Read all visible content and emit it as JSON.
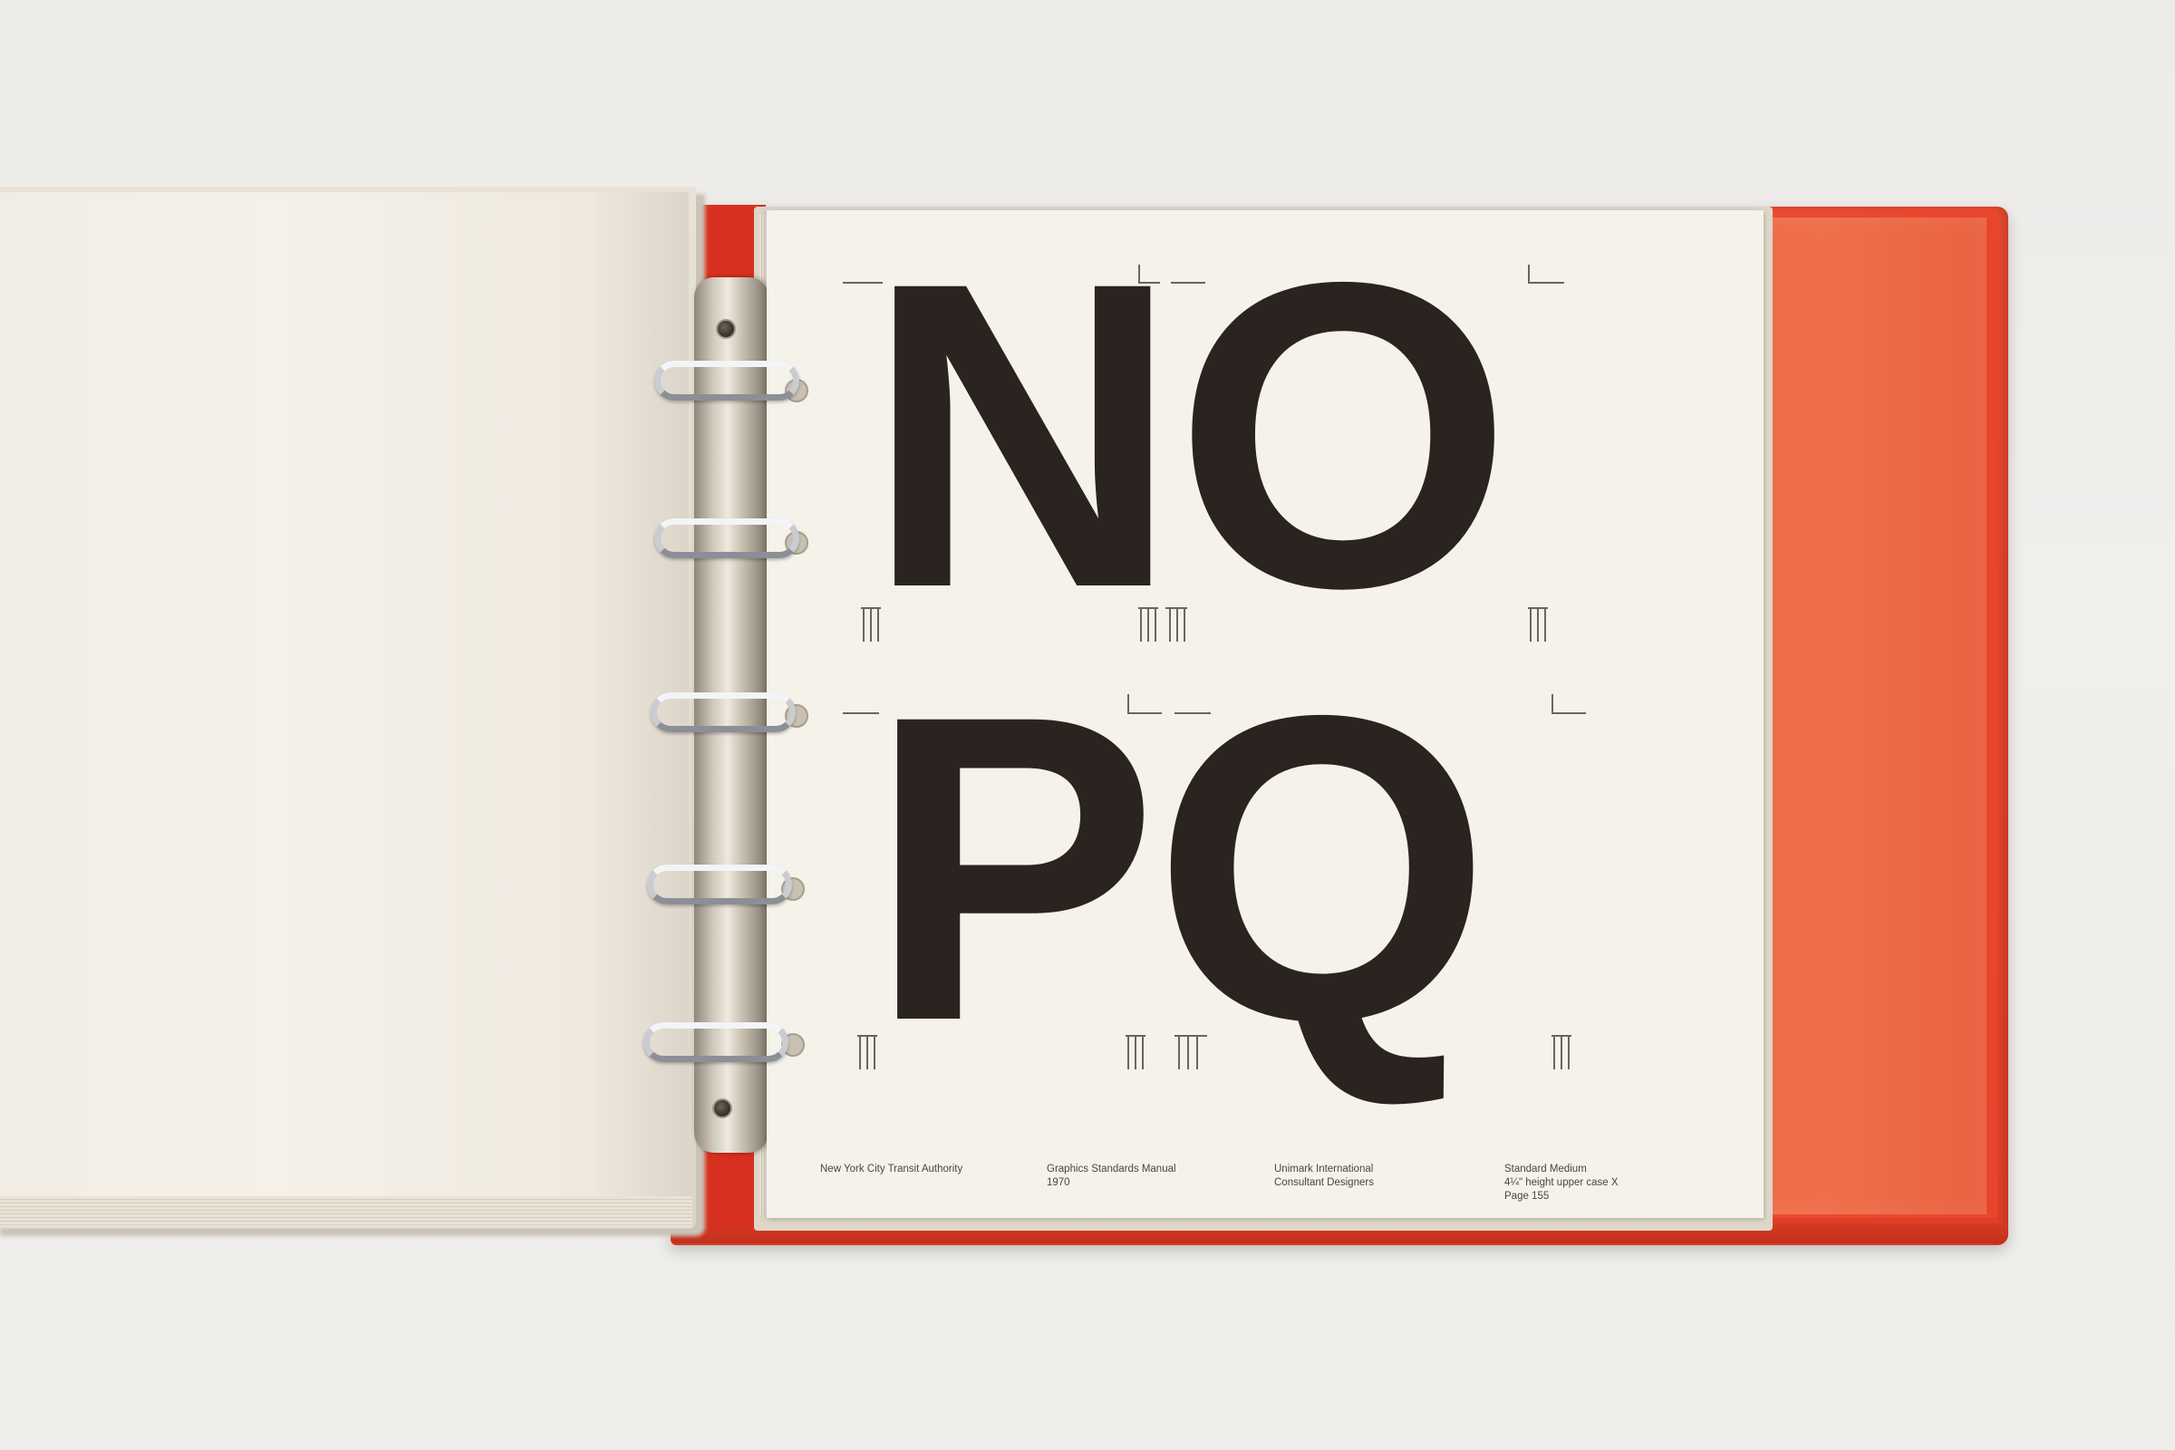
{
  "sample_letters": {
    "row1": "NO",
    "row2": "PQ"
  },
  "footer": {
    "col1": {
      "line1": "New York City Transit Authority"
    },
    "col2": {
      "line1": "Graphics Standards Manual",
      "line2": "1970"
    },
    "col3": {
      "line1": "Unimark International",
      "line2": "Consultant Designers"
    },
    "col4": {
      "line1": "Standard Medium",
      "line2": "4¼\" height upper case X",
      "line3": "Page 155"
    }
  },
  "colors": {
    "binder_red": "#e4432b",
    "pocket_orange": "#ef6f4a",
    "page_paper": "#f5f2ea",
    "ink": "#2b2320"
  }
}
